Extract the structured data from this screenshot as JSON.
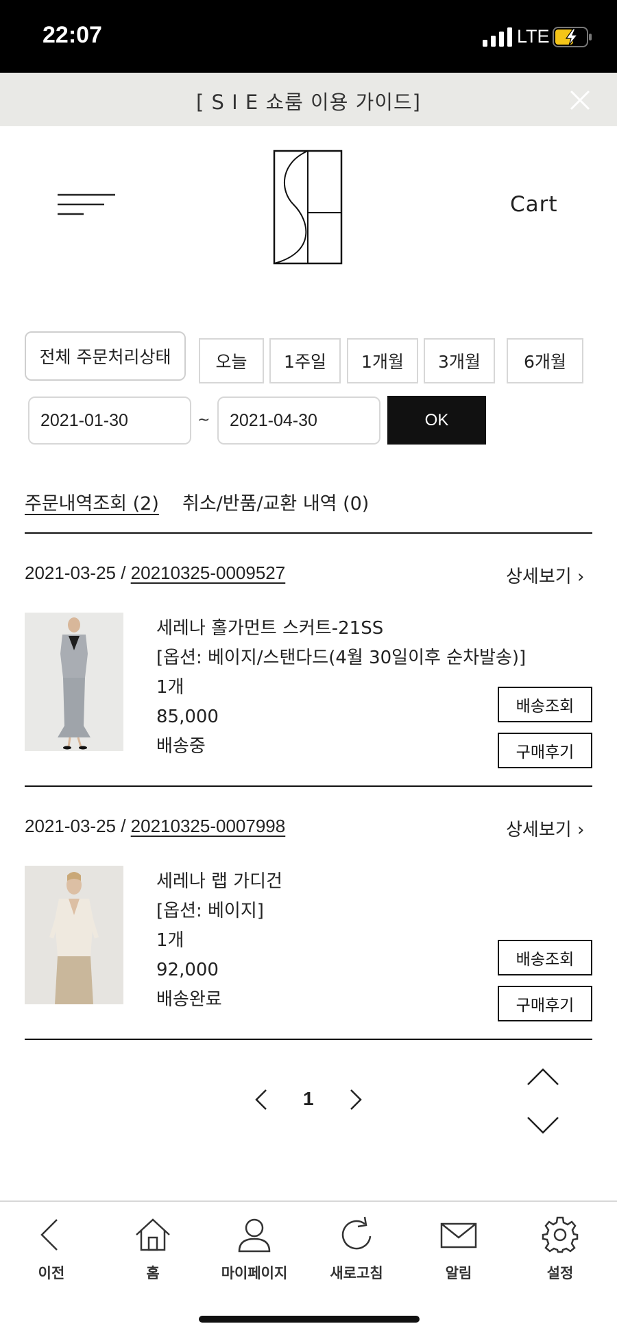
{
  "status_bar": {
    "time": "22:07",
    "network": "LTE"
  },
  "banner": {
    "text": "[ S I E 쇼룸 이용 가이드]"
  },
  "header": {
    "cart_label": "Cart"
  },
  "filters": {
    "status_select": "전체 주문처리상태",
    "periods": [
      "오늘",
      "1주일",
      "1개월",
      "3개월",
      "6개월"
    ],
    "start_date": "2021-01-30",
    "separator": "~",
    "end_date": "2021-04-30",
    "ok_label": "OK"
  },
  "tabs": {
    "orders": "주문내역조회 (2)",
    "returns": "취소/반품/교환 내역 (0)"
  },
  "orders": [
    {
      "date": "2021-03-25",
      "separator": " / ",
      "order_number": "20210325-0009527",
      "detail_label": "상세보기 ›",
      "product_name": "세레나 홀가먼트 스커트-21SS",
      "option": "[옵션: 베이지/스탠다드(4월 30일이후 순차발송)]",
      "quantity": "1개",
      "price": "85,000",
      "status": "배송중",
      "track_label": "배송조회",
      "review_label": "구매후기"
    },
    {
      "date": "2021-03-25",
      "separator": " / ",
      "order_number": "20210325-0007998",
      "detail_label": "상세보기 ›",
      "product_name": "세레나 랩 가디건",
      "option": "[옵션: 베이지]",
      "quantity": "1개",
      "price": "92,000",
      "status": "배송완료",
      "track_label": "배송조회",
      "review_label": "구매후기"
    }
  ],
  "pagination": {
    "current_page": "1"
  },
  "bottom_nav": [
    {
      "label": "이전",
      "icon": "back-icon"
    },
    {
      "label": "홈",
      "icon": "home-icon"
    },
    {
      "label": "마이페이지",
      "icon": "user-icon"
    },
    {
      "label": "새로고침",
      "icon": "refresh-icon"
    },
    {
      "label": "알림",
      "icon": "mail-icon"
    },
    {
      "label": "설정",
      "icon": "gear-icon"
    }
  ],
  "colors": {
    "banner_bg": "#e9e9e6",
    "ok_bg": "#111111",
    "text": "#222222"
  }
}
